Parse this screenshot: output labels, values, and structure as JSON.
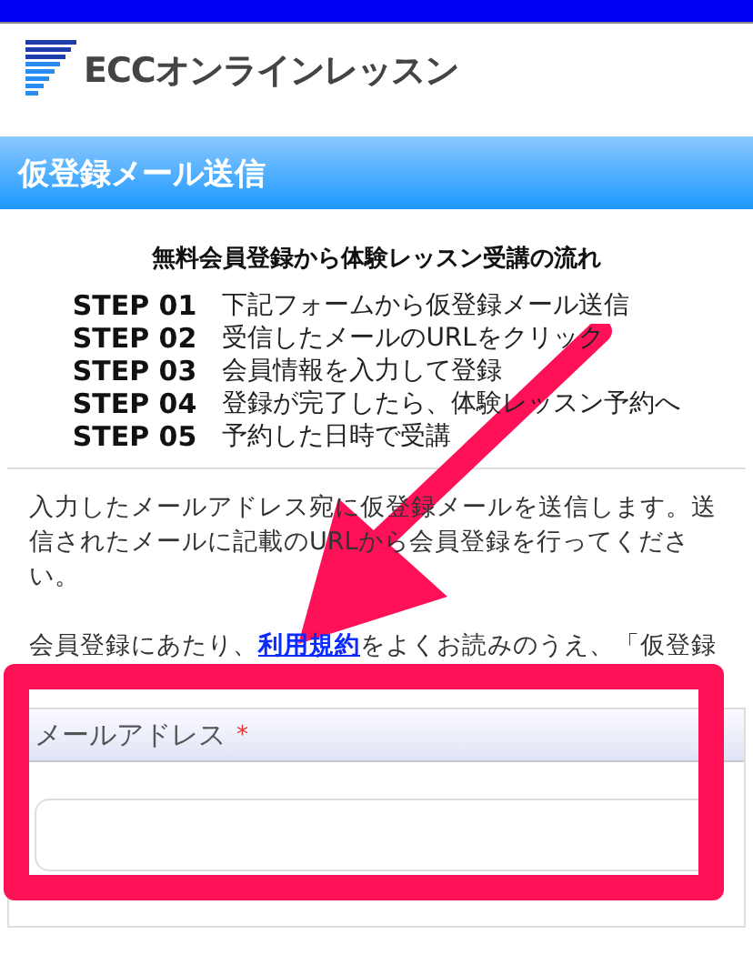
{
  "logo": {
    "text": "ECCオンラインレッスン"
  },
  "header": {
    "title": "仮登録メール送信"
  },
  "flow": {
    "title": "無料会員登録から体験レッスン受講の流れ",
    "steps": [
      {
        "label": "STEP 01",
        "text": "下記フォームから仮登録メール送信"
      },
      {
        "label": "STEP 02",
        "text": "受信したメールのURLをクリック"
      },
      {
        "label": "STEP 03",
        "text": "会員情報を入力して登録"
      },
      {
        "label": "STEP 04",
        "text": "登録が完了したら、体験レッスン予約へ"
      },
      {
        "label": "STEP 05",
        "text": "予約した日時で受講"
      }
    ]
  },
  "intro": "入力したメールアドレス宛に仮登録メールを送信します。送信されたメールに記載のURLから会員登録を行ってください。",
  "terms": {
    "before": "会員登録にあたり、",
    "link": "利用規約",
    "after": "をよくお読みのうえ、「仮登録"
  },
  "form": {
    "fields": [
      {
        "label": "メールアドレス",
        "required": true,
        "mark": "*"
      }
    ]
  }
}
